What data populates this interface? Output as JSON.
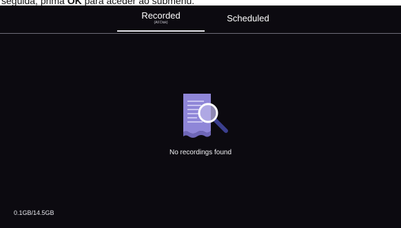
{
  "caption": {
    "before": "seguida, prima ",
    "bold": "OK",
    "after": " para aceder ao submenu."
  },
  "tabs": {
    "recorded": {
      "label": "Recorded",
      "sublabel": "(All Disk)",
      "selected": true
    },
    "scheduled": {
      "label": "Scheduled",
      "selected": false
    }
  },
  "empty_state": {
    "icon": "document-search-icon",
    "message": "No recordings found"
  },
  "storage": {
    "usage": "0.1GB/14.5GB"
  },
  "colors": {
    "background": "#0c0a10",
    "icon_accent": "#8f86d8",
    "text": "#ffffff"
  }
}
